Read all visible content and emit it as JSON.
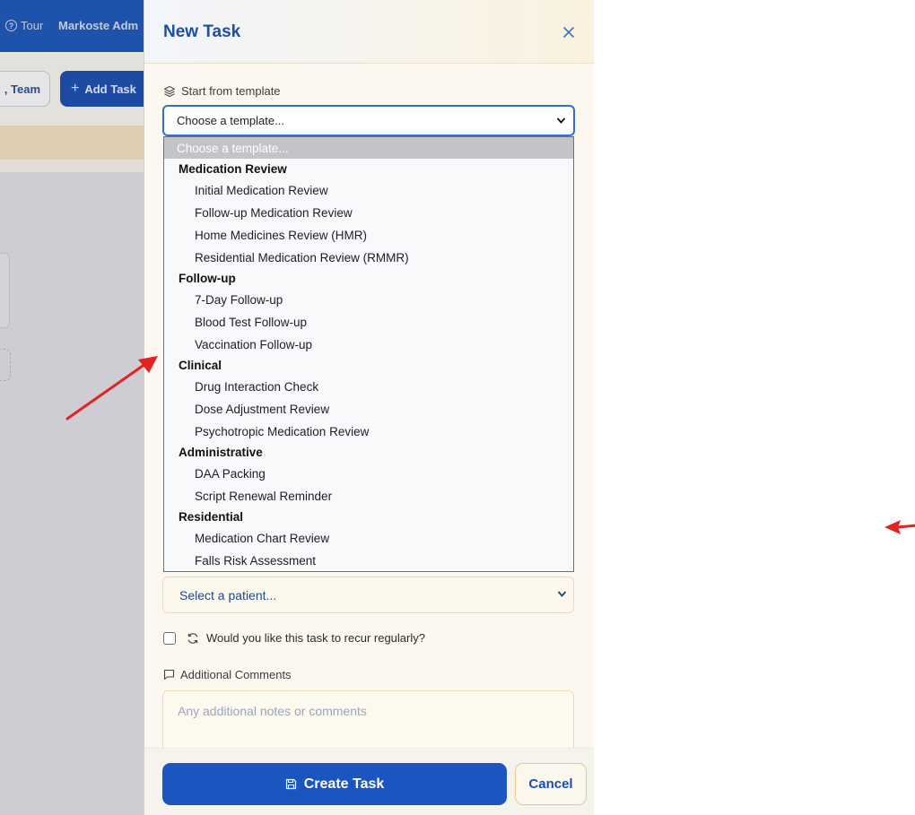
{
  "background_app": {
    "tour_label": "Tour",
    "user_label": "Markoste Adm",
    "team_button": ", Team",
    "add_task_button": "Add Task"
  },
  "modal": {
    "title": "New Task",
    "template": {
      "label": "Start from template",
      "selected": "Choose a template...",
      "placeholder_option": "Choose a template...",
      "groups": [
        {
          "label": "Medication Review",
          "options": [
            "Initial Medication Review",
            "Follow-up Medication Review",
            "Home Medicines Review (HMR)",
            "Residential Medication Review (RMMR)"
          ]
        },
        {
          "label": "Follow-up",
          "options": [
            "7-Day Follow-up",
            "Blood Test Follow-up",
            "Vaccination Follow-up"
          ]
        },
        {
          "label": "Clinical",
          "options": [
            "Drug Interaction Check",
            "Dose Adjustment Review",
            "Psychotropic Medication Review"
          ]
        },
        {
          "label": "Administrative",
          "options": [
            "DAA Packing",
            "Script Renewal Reminder"
          ]
        },
        {
          "label": "Residential",
          "options": [
            "Medication Chart Review",
            "Falls Risk Assessment"
          ]
        }
      ]
    },
    "patient": {
      "selected": "Select a patient..."
    },
    "recur": {
      "label": "Would you like this task to recur regularly?",
      "checked": false
    },
    "comments": {
      "label": "Additional Comments",
      "placeholder": "Any additional notes or comments"
    },
    "footer": {
      "create_label": "Create Task",
      "cancel_label": "Cancel"
    }
  },
  "colors": {
    "primary": "#1b55c0",
    "title_blue": "#1a4fa8",
    "annotation_red": "#e32222"
  }
}
